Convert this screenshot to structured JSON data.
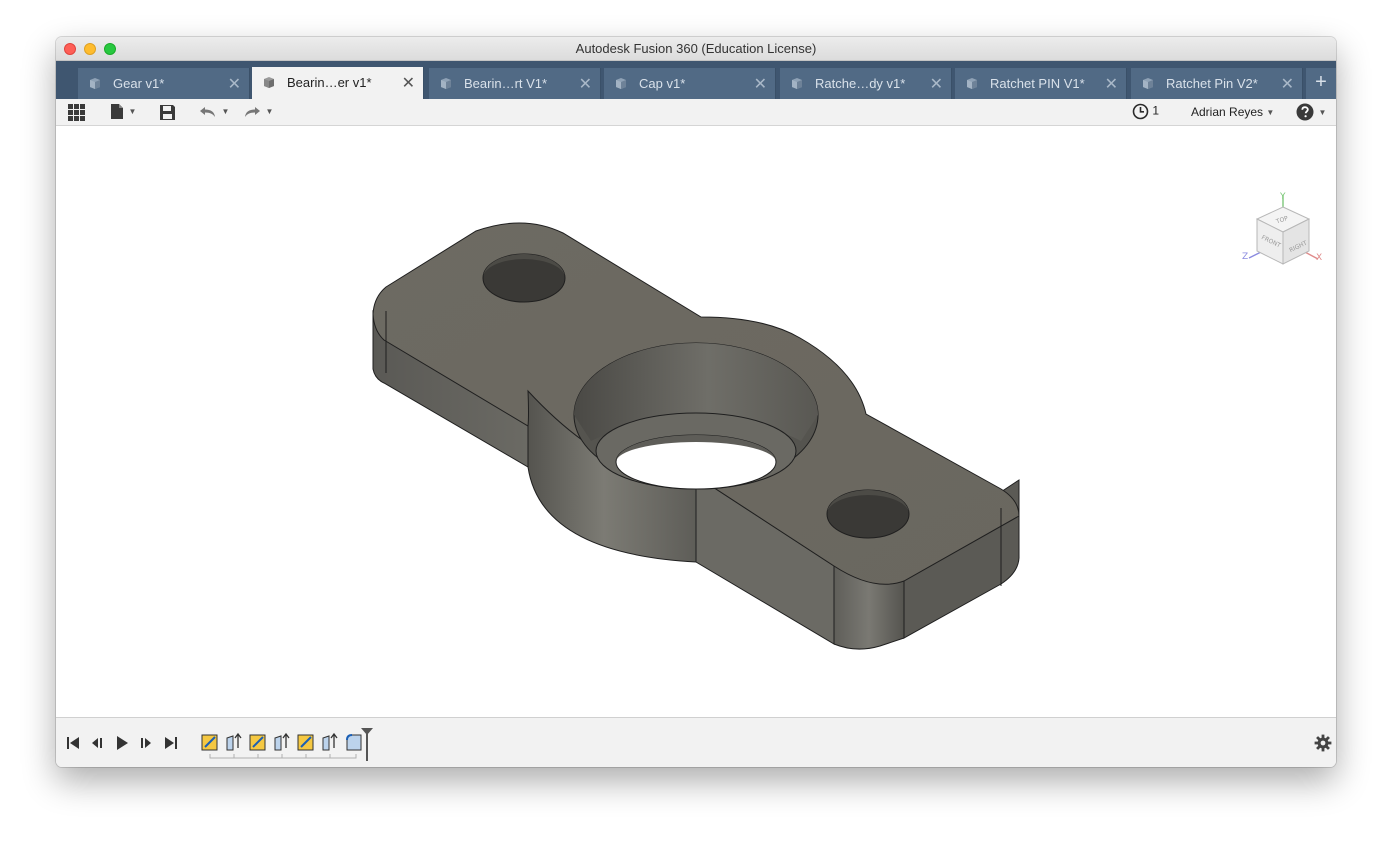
{
  "window": {
    "title": "Autodesk Fusion 360 (Education License)"
  },
  "tabs": [
    {
      "label": "Gear v1*",
      "active": false
    },
    {
      "label": "Bearin…er v1*",
      "active": true
    },
    {
      "label": "Bearin…rt V1*",
      "active": false
    },
    {
      "label": "Cap v1*",
      "active": false
    },
    {
      "label": "Ratche…dy v1*",
      "active": false
    },
    {
      "label": "Ratchet PIN V1*",
      "active": false
    },
    {
      "label": "Ratchet Pin V2*",
      "active": false
    }
  ],
  "tab_close_glyph": "✕",
  "tab_add_glyph": "+",
  "toolbar": {
    "job_status_count": "1",
    "user_name": "Adrian Reyes",
    "icons": [
      "grid-menu-icon",
      "file-icon",
      "save-icon",
      "undo-icon",
      "redo-icon",
      "clock-icon",
      "help-icon"
    ]
  },
  "viewcube": {
    "top_label": "TOP",
    "front_label": "FRONT",
    "right_label": "RIGHT",
    "axis_x": "X",
    "axis_y": "Y",
    "axis_z": "Z"
  },
  "colors": {
    "tab_bar": "#3f5670",
    "tab_inactive": "#516a85",
    "model_top": "#6e6b63",
    "model_side": "#5f5e58"
  },
  "timeline": {
    "feature_icons": [
      "sketch-icon",
      "extrude-icon",
      "sketch-icon",
      "extrude-icon",
      "sketch-icon",
      "extrude-icon",
      "fillet-icon"
    ]
  }
}
